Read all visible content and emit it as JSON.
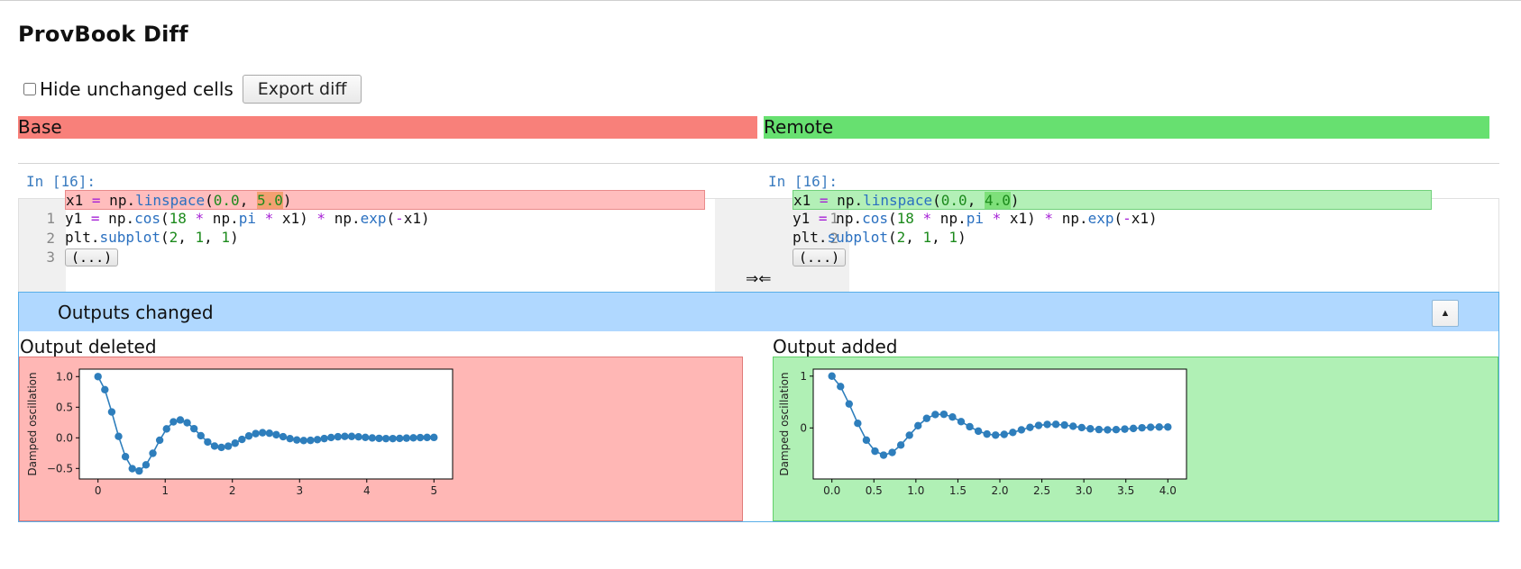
{
  "page": {
    "title": "ProvBook Diff"
  },
  "controls": {
    "hide_unchanged_label": "Hide unchanged cells",
    "hide_unchanged_checked": false,
    "export_label": "Export diff"
  },
  "headers": {
    "base": "Base",
    "remote": "Remote"
  },
  "cell": {
    "base_prompt": "In [16]:",
    "remote_prompt": "In [16]:",
    "line_numbers": [
      "1",
      "2",
      "3"
    ],
    "ellipsis": "(...)",
    "merge_symbol": "⇒⇐",
    "base_lines": [
      {
        "a": "x1 ",
        "b": "=",
        "c": " np.",
        "d": "linspace",
        "e": "(",
        "f": "0.0",
        "g": ", ",
        "h": "5.0",
        "i": ")"
      },
      "y1 = np.cos(18 * np.pi * x1) * np.exp(-x1)",
      "plt.subplot(2, 1, 1)"
    ],
    "remote_lines": [
      {
        "a": "x1 ",
        "b": "=",
        "c": " np.",
        "d": "linspace",
        "e": "(",
        "f": "0.0",
        "g": ", ",
        "h": "4.0",
        "i": ")"
      },
      "y1 = np.cos(18 * np.pi * x1) * np.exp(-x1)",
      "plt.subplot(2, 1, 1)"
    ]
  },
  "outputs": {
    "header": "Outputs changed",
    "collapse_icon": "triangle-up-icon",
    "deleted_label": "Output deleted",
    "added_label": "Output added"
  },
  "colors": {
    "base": "#f8807a",
    "remote": "#67e070",
    "series": "#2e7ebc"
  },
  "chart_data": [
    {
      "type": "line",
      "name": "deleted-output",
      "ylabel": "Damped oscillation",
      "xlim": [
        0,
        5
      ],
      "ylim": [
        -0.6,
        1.05
      ],
      "xticks": [
        0,
        1,
        2,
        3,
        4,
        5
      ],
      "yticks": [
        -0.5,
        0.0,
        0.5,
        1.0
      ],
      "ytick_labels": [
        "−0.5",
        "0.0",
        "0.5",
        "1.0"
      ],
      "formula": {
        "xmax": 5.0,
        "n": 50
      }
    },
    {
      "type": "line",
      "name": "added-output",
      "ylabel": "Damped oscillation",
      "xlim": [
        0,
        4
      ],
      "ylim": [
        -0.9,
        1.05
      ],
      "xticks": [
        0,
        0.5,
        1,
        1.5,
        2,
        2.5,
        3,
        3.5,
        4
      ],
      "xtick_labels": [
        "0.0",
        "0.5",
        "1.0",
        "1.5",
        "2.0",
        "2.5",
        "3.0",
        "3.5",
        "4.0"
      ],
      "yticks": [
        0,
        1
      ],
      "ytick_labels": [
        "0",
        "1"
      ],
      "formula": {
        "xmax": 4.0,
        "n": 40
      }
    }
  ]
}
